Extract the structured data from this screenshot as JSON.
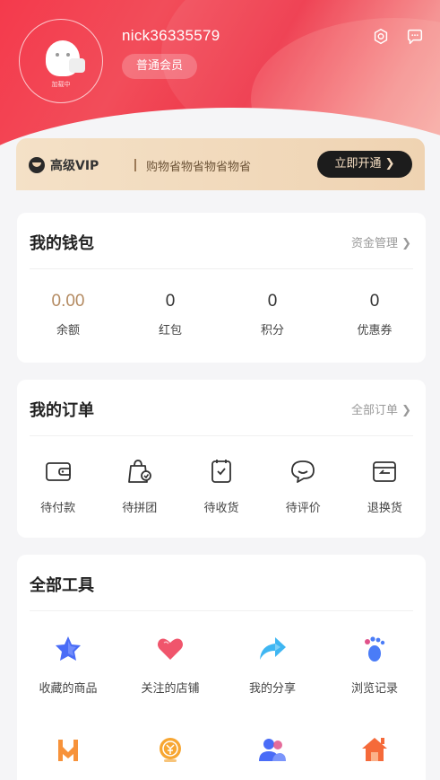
{
  "profile": {
    "username": "nick36335579",
    "member_level": "普通会员",
    "avatar_caption": "加载中"
  },
  "header_icons": {
    "settings": "settings-gear-icon",
    "message": "message-bubble-icon"
  },
  "vip": {
    "title": "高级VIP",
    "description": "购物省物省物省物省",
    "button": "立即开通 ❯"
  },
  "wallet": {
    "title": "我的钱包",
    "link": "资金管理 ❯",
    "items": [
      {
        "value": "0.00",
        "label": "余额"
      },
      {
        "value": "0",
        "label": "红包"
      },
      {
        "value": "0",
        "label": "积分"
      },
      {
        "value": "0",
        "label": "优惠券"
      }
    ]
  },
  "orders": {
    "title": "我的订单",
    "link": "全部订单 ❯",
    "items": [
      {
        "label": "待付款",
        "icon": "wallet-icon"
      },
      {
        "label": "待拼团",
        "icon": "group-bag-icon"
      },
      {
        "label": "待收货",
        "icon": "receive-box-icon"
      },
      {
        "label": "待评价",
        "icon": "comment-icon"
      },
      {
        "label": "退换货",
        "icon": "return-icon"
      }
    ]
  },
  "tools": {
    "title": "全部工具",
    "items": [
      {
        "label": "收藏的商品",
        "icon": "star-icon",
        "color": "#4a6cf7"
      },
      {
        "label": "关注的店铺",
        "icon": "heart-icon",
        "color": "#f0556c"
      },
      {
        "label": "我的分享",
        "icon": "share-arrow-icon",
        "color": "#3fb6f2"
      },
      {
        "label": "浏览记录",
        "icon": "footprint-icon",
        "color": "#4a7cf7"
      },
      {
        "label": "",
        "icon": "distribution-icon",
        "color": "#f7923a"
      },
      {
        "label": "",
        "icon": "coin-icon",
        "color": "#f7a632"
      },
      {
        "label": "",
        "icon": "team-icon",
        "color": "#4a6cf7"
      },
      {
        "label": "",
        "icon": "home-store-icon",
        "color": "#f56a3a"
      }
    ]
  }
}
